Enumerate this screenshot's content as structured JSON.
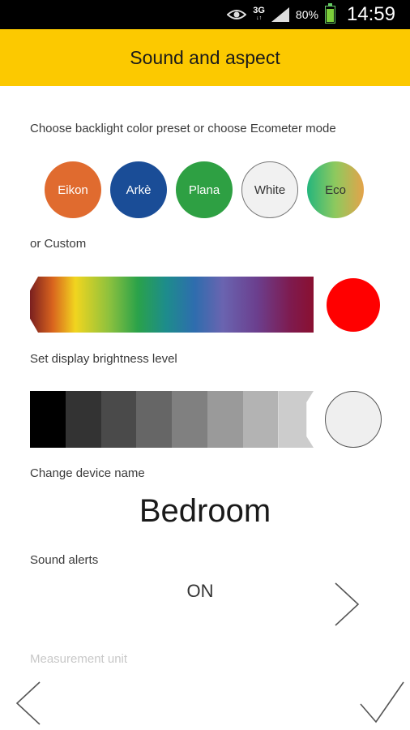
{
  "statusbar": {
    "network": "3G",
    "network_sub": "↓↑",
    "battery": "80%",
    "time": "14:59"
  },
  "appbar": {
    "title": "Sound and aspect"
  },
  "labels": {
    "preset": "Choose backlight color preset or choose Ecometer mode",
    "custom": "or Custom",
    "brightness": "Set display brightness level",
    "device_name": "Change device name",
    "sound": "Sound alerts",
    "unit": "Measurement unit"
  },
  "presets": [
    "Eikon",
    "Arkè",
    "Plana",
    "White",
    "Eco"
  ],
  "colors": {
    "accent": "#fcc900",
    "custom_color": "#ff0000",
    "eikon": "#e06b2f",
    "arke": "#1a4d97",
    "plana": "#2ea043"
  },
  "brightness_steps": [
    "#000000",
    "#333333",
    "#4a4a4a",
    "#666666",
    "#808080",
    "#9a9a9a",
    "#b3b3b3",
    "#cccccc"
  ],
  "device_name": "Bedroom",
  "sound_alerts": "ON",
  "icons": {
    "status": [
      "eye-icon",
      "signal-icon",
      "battery-icon"
    ],
    "nav": [
      "chevron-left-icon",
      "checkmark-icon",
      "chevron-right-icon"
    ]
  }
}
